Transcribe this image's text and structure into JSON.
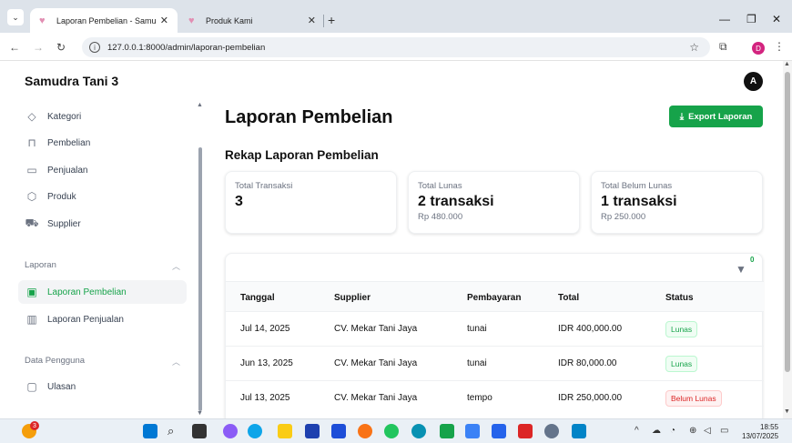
{
  "browser": {
    "tabs": [
      {
        "title": "Laporan Pembelian - Samudra T",
        "active": true
      },
      {
        "title": "Produk Kami",
        "active": false
      }
    ],
    "new_tab": "+",
    "url": "127.0.0.1:8000/admin/laporan-pembelian",
    "profile_initial": "D"
  },
  "app": {
    "brand": "Samudra Tani 3",
    "user_initial": "A"
  },
  "sidebar": {
    "items": [
      {
        "label": "Kategori",
        "icon": "tag-icon"
      },
      {
        "label": "Pembelian",
        "icon": "shopping-bag-icon"
      },
      {
        "label": "Penjualan",
        "icon": "inbox-icon"
      },
      {
        "label": "Produk",
        "icon": "cube-icon"
      },
      {
        "label": "Supplier",
        "icon": "truck-icon"
      }
    ],
    "groups": [
      {
        "label": "Laporan",
        "items": [
          {
            "label": "Laporan Pembelian",
            "icon": "document-icon",
            "active": true
          },
          {
            "label": "Laporan Penjualan",
            "icon": "chart-bar-icon",
            "active": false
          }
        ]
      },
      {
        "label": "Data Pengguna",
        "items": [
          {
            "label": "Ulasan",
            "icon": "chat-icon",
            "active": false
          }
        ]
      }
    ]
  },
  "page": {
    "title": "Laporan Pembelian",
    "export_label": "Export Laporan",
    "section_title": "Rekap Laporan Pembelian",
    "stats": [
      {
        "label": "Total Transaksi",
        "value": "3",
        "sub": ""
      },
      {
        "label": "Total Lunas",
        "value": "2 transaksi",
        "sub": "Rp 480.000"
      },
      {
        "label": "Total Belum Lunas",
        "value": "1 transaksi",
        "sub": "Rp 250.000"
      }
    ],
    "filter_count": "0",
    "table": {
      "columns": [
        "Tanggal",
        "Supplier",
        "Pembayaran",
        "Total",
        "Status"
      ],
      "rows": [
        {
          "tanggal": "Jul 14, 2025",
          "supplier": "CV. Mekar Tani Jaya",
          "pembayaran": "tunai",
          "total": "IDR 400,000.00",
          "status": "Lunas"
        },
        {
          "tanggal": "Jun 13, 2025",
          "supplier": "CV. Mekar Tani Jaya",
          "pembayaran": "tunai",
          "total": "IDR 80,000.00",
          "status": "Lunas"
        },
        {
          "tanggal": "Jul 13, 2025",
          "supplier": "CV. Mekar Tani Jaya",
          "pembayaran": "tempo",
          "total": "IDR 250,000.00",
          "status": "Belum Lunas"
        }
      ]
    }
  },
  "taskbar": {
    "time": "18:55",
    "date": "13/07/2025",
    "notification_count": "3"
  },
  "colors": {
    "accent": "#16a34a",
    "danger": "#dc2626",
    "tabbar": "#dde3ea"
  }
}
